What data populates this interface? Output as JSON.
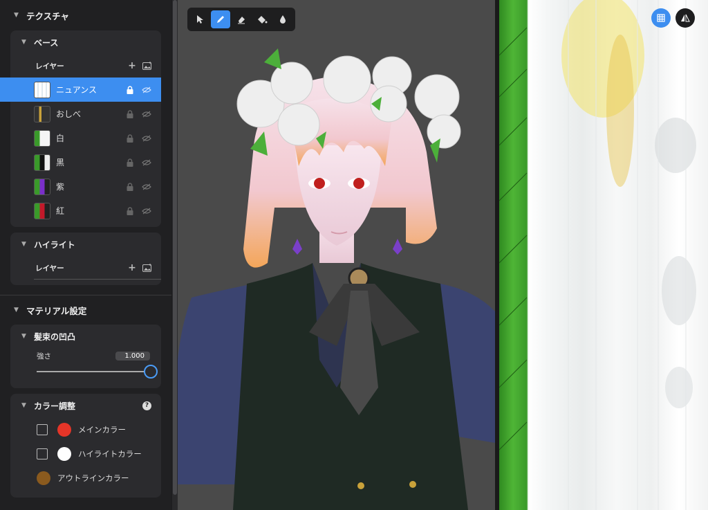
{
  "sidebar": {
    "texture_section": "テクスチャ",
    "base_group": {
      "title": "ベース",
      "layer_header": "レイヤー",
      "layers": [
        {
          "name": "ニュアンス",
          "active": true
        },
        {
          "name": "おしべ",
          "active": false
        },
        {
          "name": "白",
          "active": false
        },
        {
          "name": "黒",
          "active": false
        },
        {
          "name": "紫",
          "active": false
        },
        {
          "name": "紅",
          "active": false
        }
      ]
    },
    "highlight_group": {
      "title": "ハイライト",
      "layer_header": "レイヤー"
    },
    "material_section": "マテリアル設定",
    "hair_bump_group": {
      "title": "髪束の凹凸",
      "strength_label": "強さ",
      "strength_value": "1.000",
      "strength_fraction": 1.0
    },
    "color_adjust_group": {
      "title": "カラー調整",
      "items": [
        {
          "label": "メインカラー",
          "color": "#e53528",
          "has_checkbox": true
        },
        {
          "label": "ハイライトカラー",
          "color": "#ffffff",
          "has_checkbox": true
        },
        {
          "label": "アウトラインカラー",
          "color": "#8a5a1e",
          "has_checkbox": false
        }
      ]
    }
  },
  "viewport": {
    "tools": [
      "select-arrow-icon",
      "pen-icon",
      "eraser-icon",
      "fill-bucket-icon",
      "eyedropper-drop-icon"
    ],
    "active_tool": "pen-icon",
    "background_color": "#4a4a4a"
  },
  "texture_panel": {
    "buttons": [
      "grid-view-icon",
      "mirror-symmetry-icon"
    ]
  },
  "colors": {
    "accent": "#3d8ef0",
    "sidebar_bg": "#202022",
    "group_bg": "#2b2b2e"
  }
}
